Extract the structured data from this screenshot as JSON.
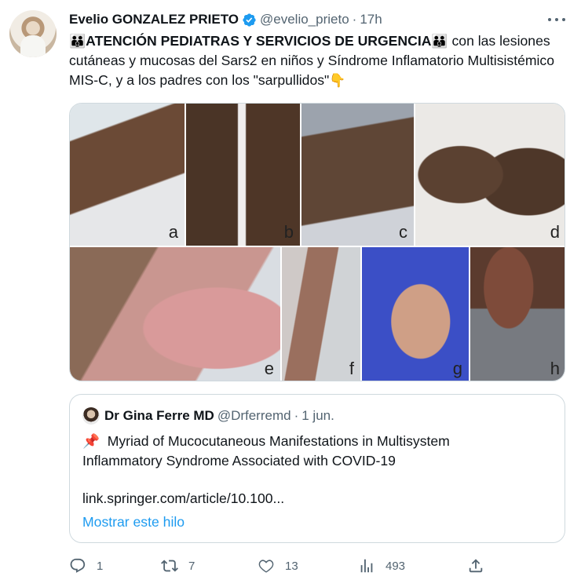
{
  "tweet": {
    "author_name": "Evelio GONZALEZ PRIETO",
    "handle": "@evelio_prieto",
    "separator": "·",
    "time": "17h",
    "text_emoji_left": "👪",
    "text_bold": "ATENCIÓN PEDIATRAS Y SERVICIOS DE URGENCIA",
    "text_emoji_right": "👪",
    "text_body": " con las lesiones cutáneas y mucosas del Sars2 en niños y Síndrome Inflamatorio Multisistémico MIS-C, y a los padres con los \"sarpullidos\"",
    "text_emoji_end": "👇",
    "image_panels": [
      "a",
      "b",
      "c",
      "d",
      "e",
      "f",
      "g",
      "h"
    ]
  },
  "quote": {
    "author_name": "Dr Gina Ferre MD",
    "handle": "@Drferremd",
    "separator": "·",
    "time": "1 jun.",
    "pin_emoji": "📌",
    "text": "Myriad of Mucocutaneous Manifestations in Multisystem Inflammatory Syndrome Associated with COVID-19",
    "link": "link.springer.com/article/10.100...",
    "show_thread": "Mostrar este hilo"
  },
  "actions": {
    "replies": "1",
    "retweets": "7",
    "likes": "13",
    "views": "493"
  },
  "colors": {
    "accent": "#1d9bf0",
    "muted": "#536471",
    "text": "#0f1419",
    "border": "#cfd9de"
  }
}
